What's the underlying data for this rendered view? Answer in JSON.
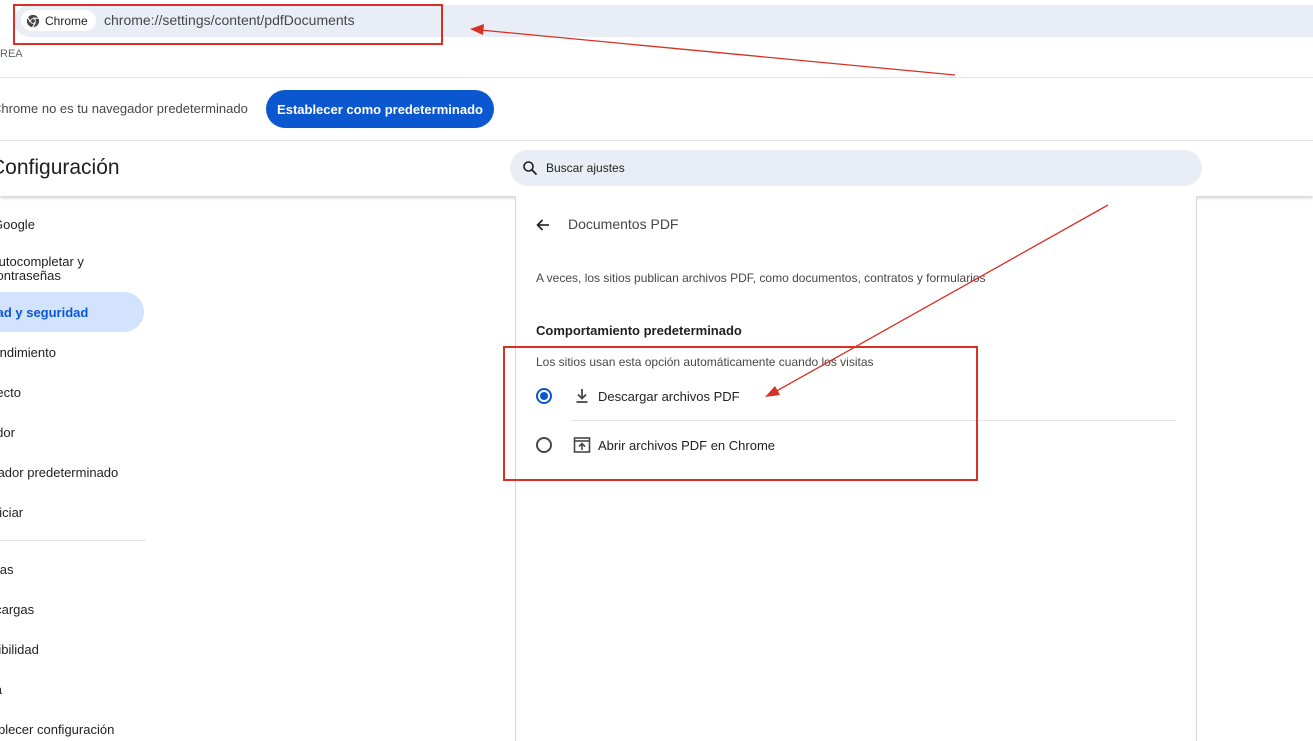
{
  "browser": {
    "chip_label": "Chrome",
    "url": "chrome://settings/content/pdfDocuments",
    "subrow_text": "REA"
  },
  "banner": {
    "text": "Chrome no es tu navegador predeterminado",
    "button_label": "Establecer como predeterminado"
  },
  "header": {
    "title": "Configuración",
    "search_placeholder": "Buscar ajustes"
  },
  "sidebar": {
    "items": [
      {
        "label": "Google"
      },
      {
        "label": "Autocompletar y contraseñas"
      },
      {
        "label": "Privacidad y seguridad"
      },
      {
        "label": "Rendimiento"
      },
      {
        "label": "Aspecto"
      },
      {
        "label": "Buscador"
      },
      {
        "label": "Navegador predeterminado"
      },
      {
        "label": "Al iniciar"
      }
    ],
    "items2": [
      {
        "label": "Idiomas"
      },
      {
        "label": "Descargas"
      },
      {
        "label": "Accesibilidad"
      },
      {
        "label": "Sistema"
      },
      {
        "label": "Restablecer configuración"
      }
    ]
  },
  "pdf_page": {
    "title": "Documentos PDF",
    "description": "A veces, los sitios publican archivos PDF, como documentos, contratos y formularios",
    "section_title": "Comportamiento predeterminado",
    "section_subtitle": "Los sitios usan esta opción automáticamente cuando los visitas",
    "options": [
      {
        "label": "Descargar archivos PDF",
        "icon": "download-icon",
        "selected": true
      },
      {
        "label": "Abrir archivos PDF en Chrome",
        "icon": "open-in-browser-icon",
        "selected": false
      }
    ]
  },
  "colors": {
    "accent": "#0b57d0",
    "active_bg": "#d3e3fd",
    "annotation": "#d93025"
  }
}
